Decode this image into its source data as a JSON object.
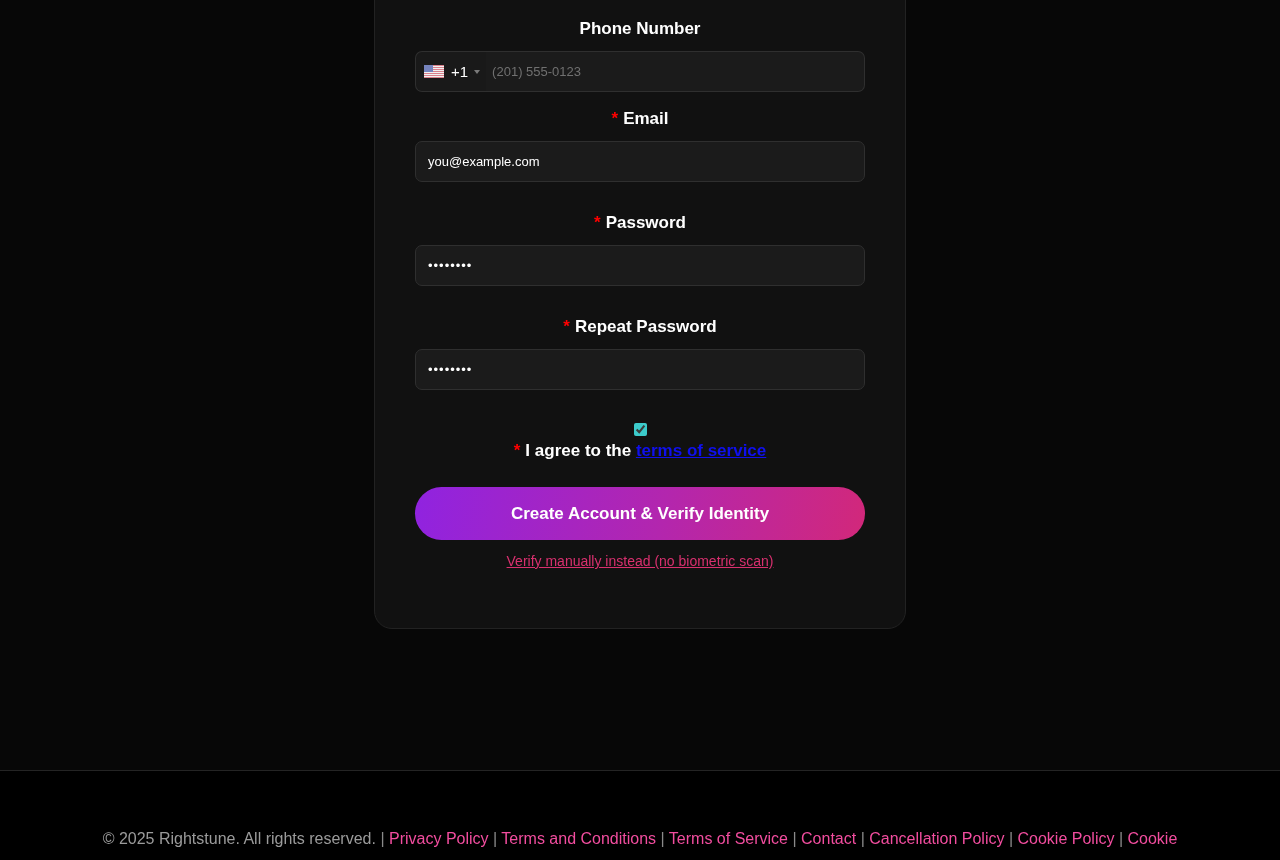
{
  "form": {
    "fields": [
      {
        "kind": "phone",
        "label": "Phone Number",
        "country_code": "+1",
        "placeholder": "(201) 555-0123"
      },
      {
        "kind": "text",
        "label": "Email",
        "required_mark": "*",
        "value": "you@example.com"
      },
      {
        "kind": "password",
        "label": "Password",
        "required_mark": "*",
        "value": "••••••••"
      },
      {
        "kind": "password",
        "label": "Repeat Password",
        "required_mark": "*",
        "value": "••••••••"
      }
    ],
    "terms": {
      "checked": true,
      "required_mark": "*",
      "text": "I agree to the",
      "link": "terms of service"
    },
    "submit_button": "Create Account & Verify Identity",
    "manual_link": "Verify manually instead (no biometric scan)"
  },
  "footer": {
    "copyright": "© 2025 Rightstune. All rights reserved.",
    "separator": "|",
    "links": [
      "Privacy Policy",
      "Terms and Conditions",
      "Terms of Service",
      "Contact",
      "Cancellation Policy",
      "Cookie Policy",
      "Cookie"
    ]
  }
}
